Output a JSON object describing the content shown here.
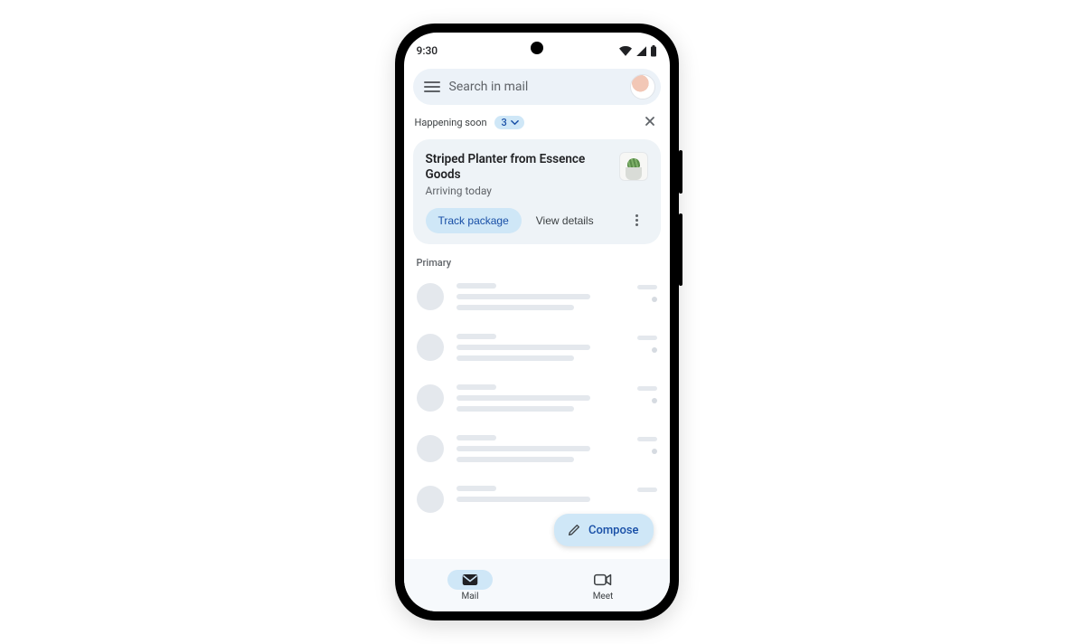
{
  "status": {
    "time": "9:30"
  },
  "search": {
    "placeholder": "Search in mail"
  },
  "happening_soon": {
    "label": "Happening soon",
    "count": "3"
  },
  "card": {
    "title": "Striped Planter from Essence Goods",
    "subtitle": "Arriving today",
    "track_label": "Track package",
    "details_label": "View details"
  },
  "section": {
    "primary": "Primary"
  },
  "compose": {
    "label": "Compose"
  },
  "nav": {
    "mail": "Mail",
    "meet": "Meet"
  }
}
